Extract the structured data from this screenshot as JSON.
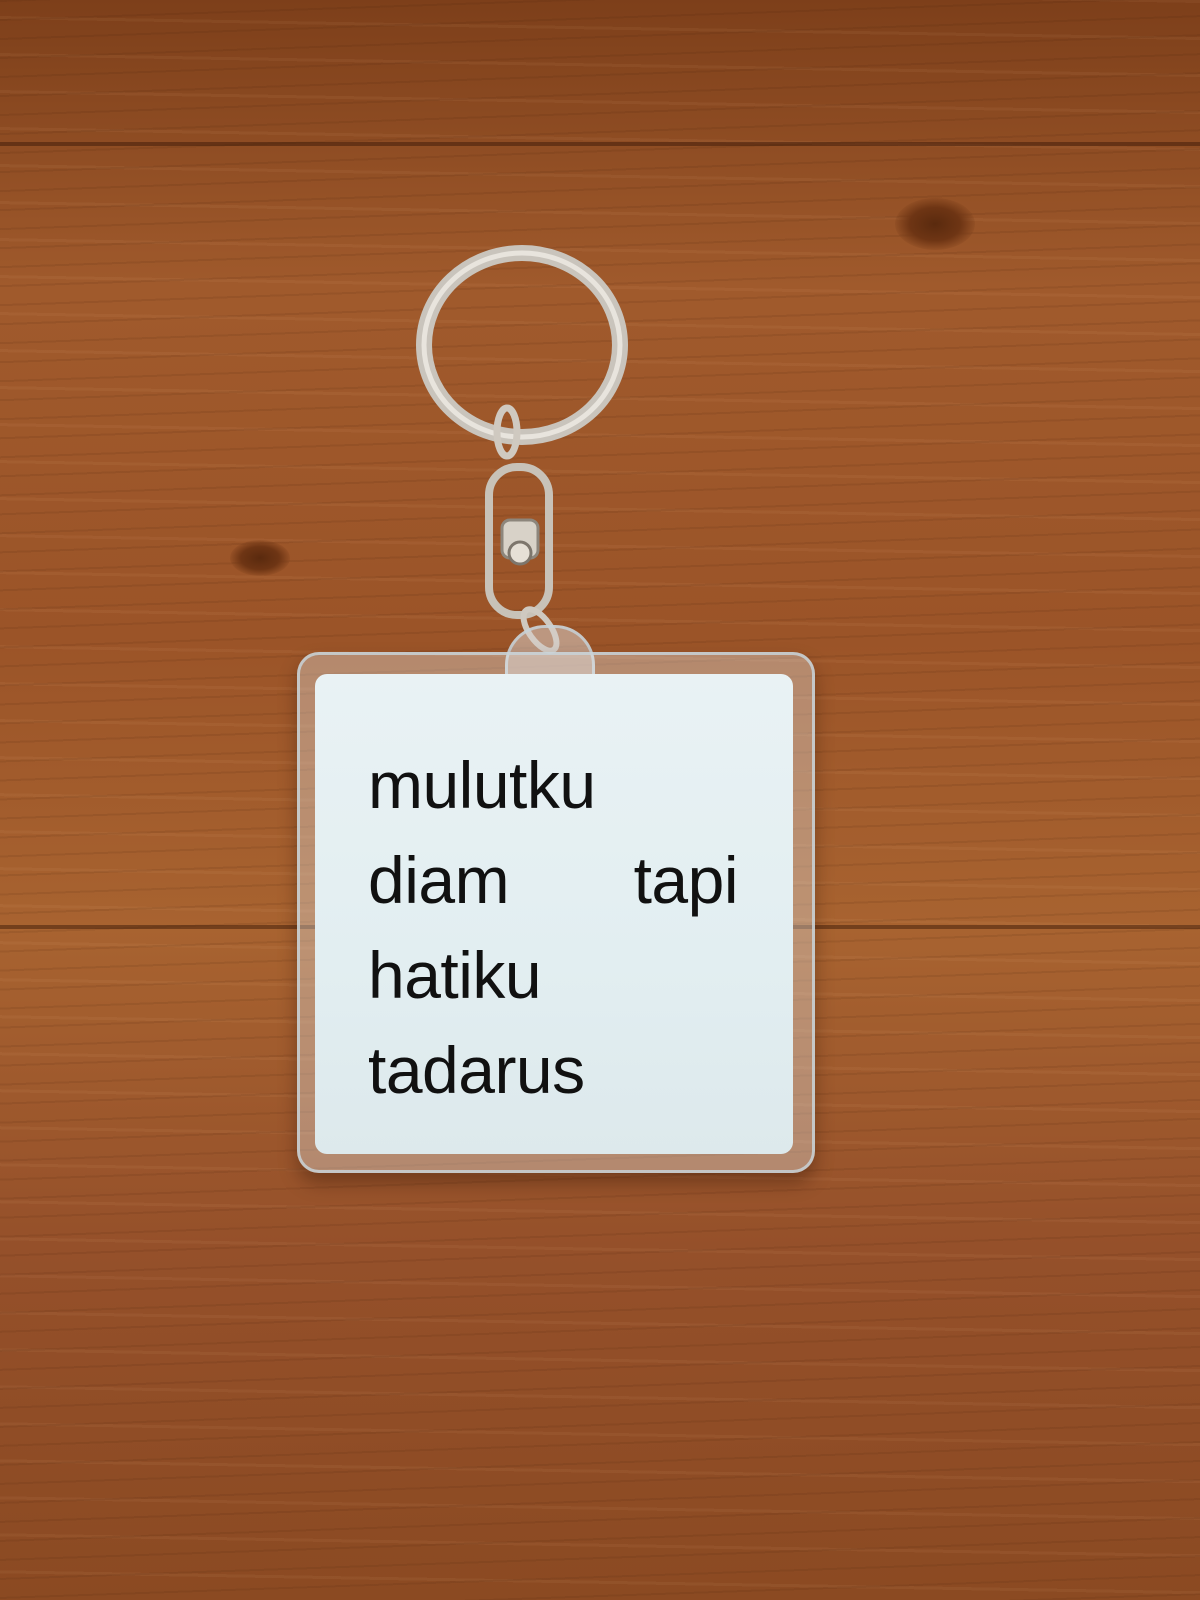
{
  "image": {
    "description_type": "photo",
    "background_color": "#9b5428",
    "tag_insert_color": "#e5f0f2",
    "text_color": "#111111"
  },
  "keychain": {
    "text_lines": [
      "mulutku",
      "diam",
      "tapi",
      "hatiku",
      "tadarus"
    ]
  }
}
